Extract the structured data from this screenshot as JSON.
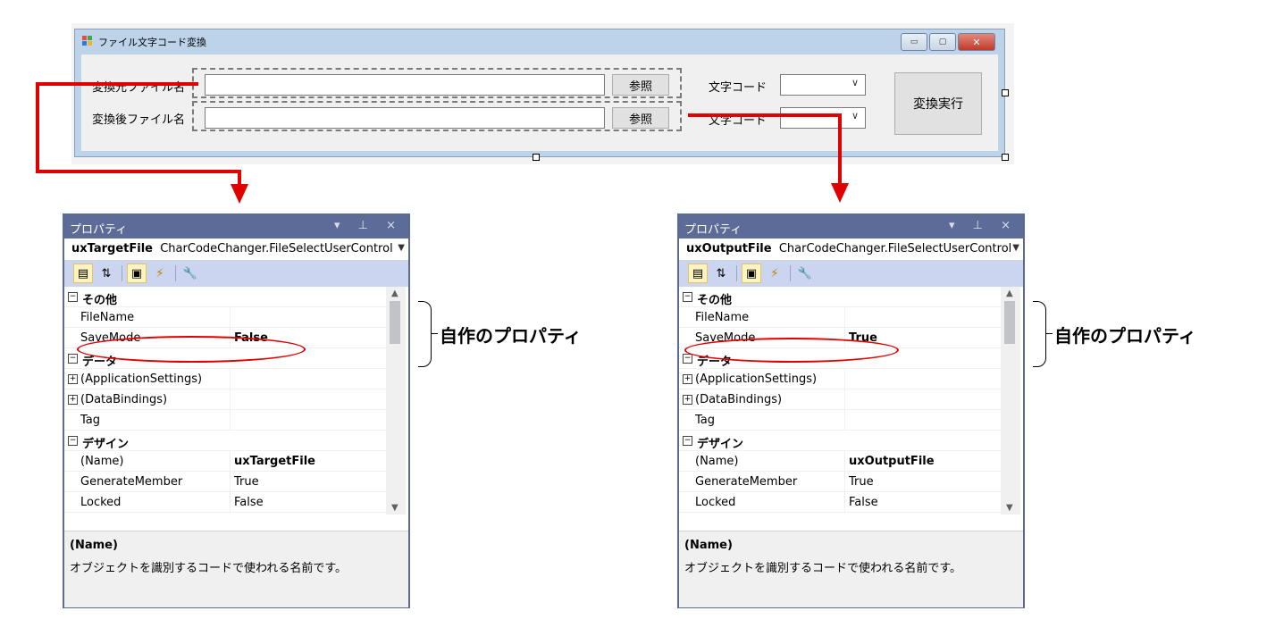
{
  "form": {
    "title": "ファイル文字コード変換",
    "row1": {
      "label": "変換元ファイル名",
      "browse": "参照",
      "code_label": "文字コード",
      "code_value": ""
    },
    "row2": {
      "label": "変換後ファイル名",
      "browse": "参照",
      "code_label": "文字コード",
      "code_value": ""
    },
    "execute": "変換実行",
    "window_buttons": {
      "minimize": "▭",
      "maximize": "▢",
      "close": "✕"
    }
  },
  "panels": [
    {
      "title": "プロパティ",
      "title_controls": "▾ ⊥ ×",
      "object_name": "uxTargetFile",
      "object_type": "CharCodeChanger.FileSelectUserControl",
      "rows": [
        {
          "type": "category",
          "name": "その他"
        },
        {
          "type": "prop",
          "name": "FileName",
          "value": ""
        },
        {
          "type": "prop",
          "name": "SaveMode",
          "value": "False",
          "bold": true
        },
        {
          "type": "category",
          "name": "データ"
        },
        {
          "type": "expandable",
          "name": "(ApplicationSettings)",
          "value": ""
        },
        {
          "type": "expandable",
          "name": "(DataBindings)",
          "value": ""
        },
        {
          "type": "prop",
          "name": "Tag",
          "value": ""
        },
        {
          "type": "category",
          "name": "デザイン"
        },
        {
          "type": "prop",
          "name": "(Name)",
          "value": "uxTargetFile",
          "bold": true
        },
        {
          "type": "prop",
          "name": "GenerateMember",
          "value": "True"
        },
        {
          "type": "prop",
          "name": "Locked",
          "value": "False"
        }
      ],
      "desc_title": "(Name)",
      "desc_text": "オブジェクトを識別するコードで使われる名前です。"
    },
    {
      "title": "プロパティ",
      "title_controls": "▾ ⊥ ×",
      "object_name": "uxOutputFile",
      "object_type": "CharCodeChanger.FileSelectUserControl",
      "rows": [
        {
          "type": "category",
          "name": "その他"
        },
        {
          "type": "prop",
          "name": "FileName",
          "value": ""
        },
        {
          "type": "prop",
          "name": "SaveMode",
          "value": "True",
          "bold": true
        },
        {
          "type": "category",
          "name": "データ"
        },
        {
          "type": "expandable",
          "name": "(ApplicationSettings)",
          "value": ""
        },
        {
          "type": "expandable",
          "name": "(DataBindings)",
          "value": ""
        },
        {
          "type": "prop",
          "name": "Tag",
          "value": ""
        },
        {
          "type": "category",
          "name": "デザイン"
        },
        {
          "type": "prop",
          "name": "(Name)",
          "value": "uxOutputFile",
          "bold": true
        },
        {
          "type": "prop",
          "name": "GenerateMember",
          "value": "True"
        },
        {
          "type": "prop",
          "name": "Locked",
          "value": "False"
        }
      ],
      "desc_title": "(Name)",
      "desc_text": "オブジェクトを識別するコードで使われる名前です。"
    }
  ],
  "annotation": "自作のプロパティ",
  "colors": {
    "accent_red": "#e00000",
    "panel_title": "#5d6b99",
    "toolbar": "#ccd5f0"
  }
}
